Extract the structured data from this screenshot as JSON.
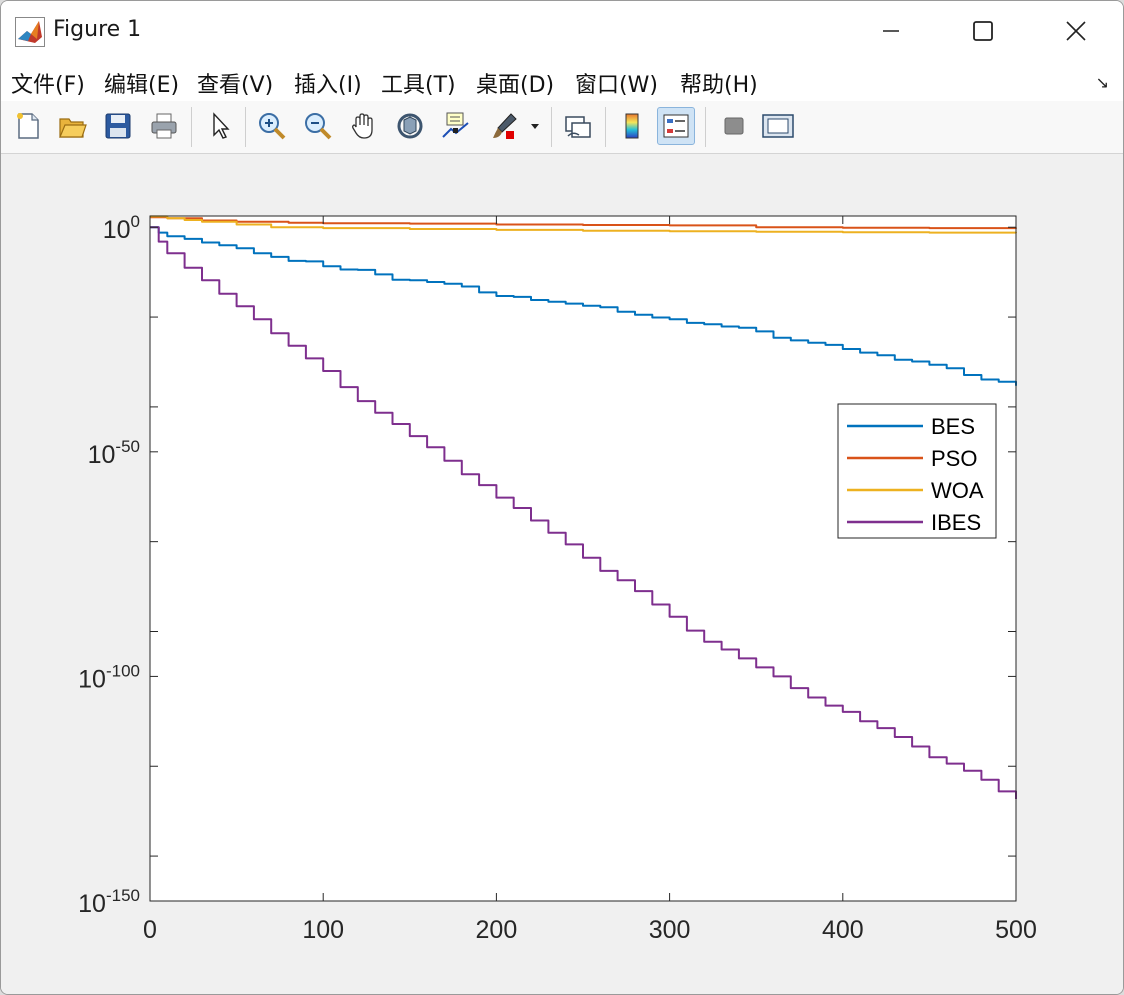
{
  "window": {
    "title": "Figure 1"
  },
  "menu": {
    "items": [
      {
        "label": "文件(F)"
      },
      {
        "label": "编辑(E)"
      },
      {
        "label": "查看(V)"
      },
      {
        "label": "插入(I)"
      },
      {
        "label": "工具(T)"
      },
      {
        "label": "桌面(D)"
      },
      {
        "label": "窗口(W)"
      },
      {
        "label": "帮助(H)"
      }
    ]
  },
  "toolbar": {
    "buttons": [
      {
        "name": "new-figure-icon"
      },
      {
        "name": "open-file-icon"
      },
      {
        "name": "save-icon"
      },
      {
        "name": "print-icon"
      },
      {
        "name": "edit-plot-arrow-icon"
      },
      {
        "name": "zoom-in-icon"
      },
      {
        "name": "zoom-out-icon"
      },
      {
        "name": "pan-hand-icon"
      },
      {
        "name": "rotate-3d-icon"
      },
      {
        "name": "data-cursor-icon"
      },
      {
        "name": "brush-icon"
      },
      {
        "name": "link-plot-icon"
      },
      {
        "name": "colorbar-icon"
      },
      {
        "name": "legend-icon"
      },
      {
        "name": "hide-plot-tools-icon"
      },
      {
        "name": "show-plot-tools-icon"
      }
    ]
  },
  "colors": {
    "BES": "#0072BD",
    "PSO": "#D95319",
    "WOA": "#EDB120",
    "IBES": "#7E2F8E"
  },
  "chart_data": {
    "type": "line",
    "title": "",
    "xlabel": "",
    "ylabel": "",
    "xlim": [
      0,
      500
    ],
    "ylim_log10": [
      -150,
      2.5
    ],
    "yscale": "log",
    "grid": false,
    "legend_position": "right",
    "x_ticks": [
      {
        "label": "0",
        "value": 0
      },
      {
        "label": "100",
        "value": 100
      },
      {
        "label": "200",
        "value": 200
      },
      {
        "label": "300",
        "value": 300
      },
      {
        "label": "400",
        "value": 400
      },
      {
        "label": "500",
        "value": 500
      }
    ],
    "y_ticks": [
      {
        "base": "10",
        "exp": "0",
        "log10": 0
      },
      {
        "base": "10",
        "exp": "-50",
        "log10": -50
      },
      {
        "base": "10",
        "exp": "-100",
        "log10": -100
      },
      {
        "base": "10",
        "exp": "-150",
        "log10": -150
      }
    ],
    "y_minor_ticks_log10": [
      -20,
      -40,
      -70,
      -90,
      -120,
      -140
    ],
    "series": [
      {
        "name": "BES",
        "x": [
          0,
          5,
          10,
          20,
          30,
          40,
          50,
          60,
          70,
          80,
          90,
          100,
          110,
          120,
          130,
          140,
          150,
          160,
          170,
          180,
          190,
          200,
          210,
          220,
          230,
          240,
          250,
          260,
          270,
          280,
          290,
          300,
          310,
          320,
          330,
          340,
          350,
          360,
          370,
          380,
          390,
          400,
          410,
          420,
          430,
          440,
          450,
          460,
          470,
          480,
          490,
          500
        ],
        "log10_y": [
          0,
          -1.2,
          -2.0,
          -2.6,
          -3.4,
          -4.0,
          -4.7,
          -5.8,
          -6.6,
          -7.5,
          -7.6,
          -8.7,
          -9.4,
          -9.5,
          -10.5,
          -11.7,
          -11.8,
          -12.2,
          -12.6,
          -13.2,
          -14.5,
          -15.3,
          -15.5,
          -16.2,
          -16.6,
          -17.0,
          -17.5,
          -17.8,
          -18.8,
          -19.5,
          -20.1,
          -20.5,
          -21.3,
          -21.6,
          -22.1,
          -22.4,
          -23.2,
          -24.6,
          -25.2,
          -25.7,
          -26.2,
          -27.1,
          -27.9,
          -28.5,
          -29.5,
          -29.9,
          -30.6,
          -31.4,
          -32.9,
          -33.9,
          -34.4,
          -35.3
        ]
      },
      {
        "name": "PSO",
        "x": [
          0,
          10,
          30,
          50,
          80,
          100,
          150,
          200,
          250,
          300,
          350,
          400,
          450,
          500
        ],
        "log10_y": [
          2.2,
          2.0,
          1.5,
          1.2,
          1.0,
          0.9,
          0.8,
          0.6,
          0.5,
          0.4,
          0.0,
          -0.1,
          -0.2,
          -0.3
        ]
      },
      {
        "name": "WOA",
        "x": [
          0,
          10,
          20,
          30,
          50,
          70,
          100,
          150,
          200,
          250,
          300,
          350,
          400,
          450,
          500
        ],
        "log10_y": [
          2.4,
          2.0,
          1.6,
          1.2,
          0.6,
          0.0,
          -0.2,
          -0.4,
          -0.6,
          -0.8,
          -0.9,
          -1.0,
          -1.1,
          -1.2,
          -1.3
        ]
      },
      {
        "name": "IBES",
        "x": [
          0,
          5,
          10,
          20,
          30,
          40,
          50,
          60,
          70,
          80,
          90,
          100,
          110,
          120,
          130,
          140,
          150,
          160,
          170,
          180,
          190,
          200,
          210,
          220,
          230,
          240,
          250,
          260,
          270,
          280,
          290,
          300,
          310,
          320,
          330,
          340,
          350,
          360,
          370,
          380,
          390,
          400,
          410,
          420,
          430,
          440,
          450,
          460,
          470,
          480,
          490,
          500
        ],
        "log10_y": [
          0,
          -3.2,
          -5.8,
          -9.0,
          -11.8,
          -14.8,
          -17.6,
          -20.5,
          -23.6,
          -26.4,
          -29.2,
          -32.0,
          -35.6,
          -38.7,
          -41.3,
          -43.8,
          -46.5,
          -49.0,
          -52.0,
          -55.0,
          -57.4,
          -60.2,
          -62.5,
          -65.3,
          -68.0,
          -70.6,
          -73.6,
          -76.5,
          -78.6,
          -81.0,
          -84.0,
          -86.7,
          -89.8,
          -92.3,
          -94.0,
          -96.0,
          -98.0,
          -100.0,
          -102.6,
          -104.7,
          -106.5,
          -107.9,
          -110.0,
          -111.5,
          -113.5,
          -115.6,
          -118.0,
          -119.4,
          -121.0,
          -123.0,
          -125.6,
          -127.3
        ]
      }
    ]
  }
}
